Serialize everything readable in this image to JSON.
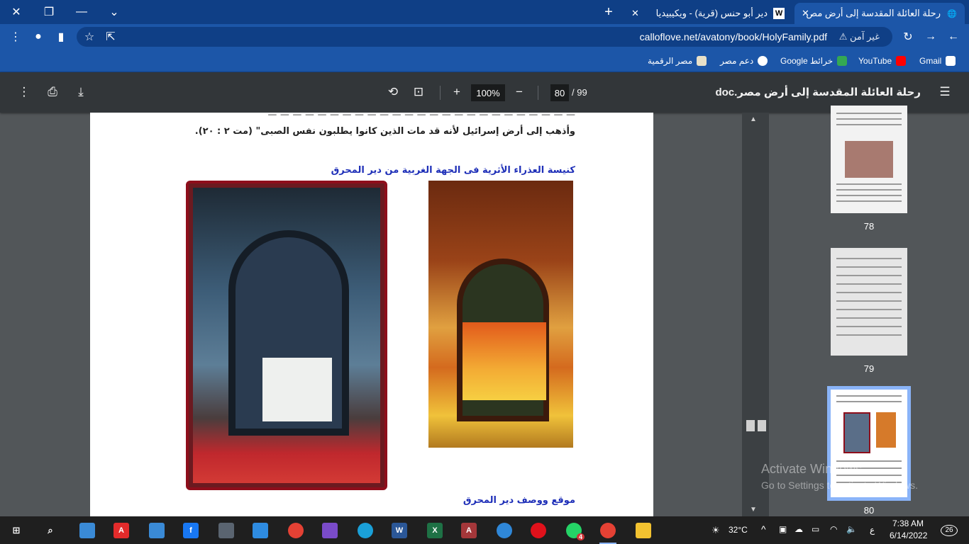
{
  "browser": {
    "tabs": [
      {
        "title": "رحلة العائلة المقدسة إلى أرض مص",
        "active": true
      },
      {
        "title": "دير أبو حنس (قرية) - ويكيبيديا",
        "active": false
      }
    ],
    "url": "calloflove.net/avatony/book/HolyFamily.pdf",
    "security_label": "غير آمن",
    "bookmarks": [
      {
        "label": "Gmail",
        "color": "#ffffff"
      },
      {
        "label": "YouTube",
        "color": "#ff0000"
      },
      {
        "label": "خرائط Google",
        "color": "#34a853"
      },
      {
        "label": "دعم مصر",
        "color": "#ffffff"
      },
      {
        "label": "مصر الرقمية",
        "color": "#e8e0c8"
      }
    ]
  },
  "pdf": {
    "title": "رحلة العائلة المقدسة إلى أرض مصر.doc",
    "current_page": "80",
    "total_pages": "/ 99",
    "zoom": "100%",
    "text_line1": "وأذهب إلى أرض إسرائيل لأنه قد مات الذين كانوا يطلبون نفس الصبى\" (مت ٢ : ٢٠).",
    "caption_top": "كنيسة العذراء الأثرية فى الجهة الغربية من دير المحرق",
    "caption_bottom": "موقع ووصف دير المحرق",
    "thumbnails": [
      {
        "label": "78"
      },
      {
        "label": "79"
      },
      {
        "label": "80"
      }
    ]
  },
  "watermark": {
    "title": "Activate Windows",
    "subtitle": "Go to Settings to activate Windows."
  },
  "taskbar": {
    "temperature": "32°C",
    "time": "7:38 AM",
    "date": "6/14/2022",
    "notifications": "26",
    "whatsapp_badge": "4",
    "lang": "ع"
  }
}
